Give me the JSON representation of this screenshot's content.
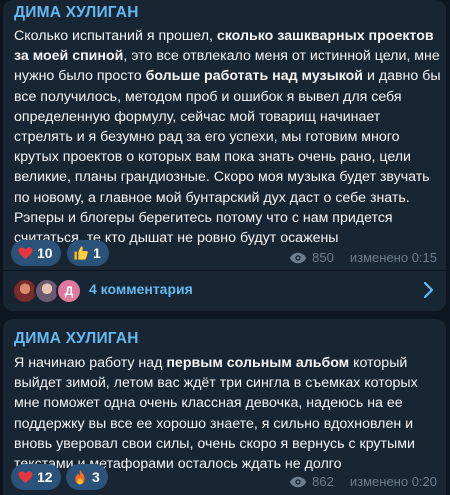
{
  "posts": [
    {
      "author": "ДИМА ХУЛИГАН",
      "segments": [
        {
          "text": "Сколько испытаний я прошел, ",
          "bold": false
        },
        {
          "text": "сколько зашкварных проектов за моей спиной",
          "bold": true
        },
        {
          "text": ", это все отвлекало меня от истинной цели, мне нужно было просто ",
          "bold": false
        },
        {
          "text": "больше работать над музыкой",
          "bold": true
        },
        {
          "text": " и давно бы все получилось, методом проб и ошибок я вывел для себя определенную формулу, сейчас мой товарищ начинает стрелять и я безумно рад за его успехи, мы готовим много крутых проектов о которых вам пока знать очень рано, цели великие, планы грандиозные. Скоро моя музыка будет звучать по новому, а главное мой бунтарский дух даст о себе знать. Рэперы и блогеры берегитесь потому что с нам придется считаться, те кто дышат не ровно будут осажены",
          "bold": false
        }
      ],
      "reactions": [
        {
          "icon": "heart-icon",
          "count": "10"
        },
        {
          "icon": "thumbs-up-icon",
          "count": "1"
        }
      ],
      "views": "850",
      "edited": "изменено 0:15",
      "comments_label": "4 комментария"
    },
    {
      "author": "ДИМА ХУЛИГАН",
      "segments": [
        {
          "text": "Я начинаю работу над ",
          "bold": false
        },
        {
          "text": "первым сольным альбом",
          "bold": true
        },
        {
          "text": " который выйдет зимой, летом вас ждёт три сингла в съемках которых мне поможет одна очень классная девочка, надеюсь на ее поддержку вы все ее хорошо знаете, я сильно вдохновлен и вновь уверовал свои силы, очень скоро я вернусь с крутыми текстами и метафорами осталось ждать не долго",
          "bold": false
        }
      ],
      "reactions": [
        {
          "icon": "heart-icon",
          "count": "12"
        },
        {
          "icon": "fire-icon",
          "count": "3"
        }
      ],
      "views": "862",
      "edited": "изменено 0:20"
    }
  ],
  "avatars": [
    {
      "icon": "avatar-photo-1",
      "color": "#b8524a"
    },
    {
      "icon": "avatar-photo-2",
      "color": "#8a6f8f"
    },
    {
      "icon": "avatar-letter",
      "letter": "Д",
      "color": "#e0789e"
    }
  ],
  "colors": {
    "background": "#0e1621",
    "bubble": "#182533",
    "accent": "#64b9f2",
    "reaction_bg": "#2b5278",
    "meta": "#6d7f8f"
  }
}
